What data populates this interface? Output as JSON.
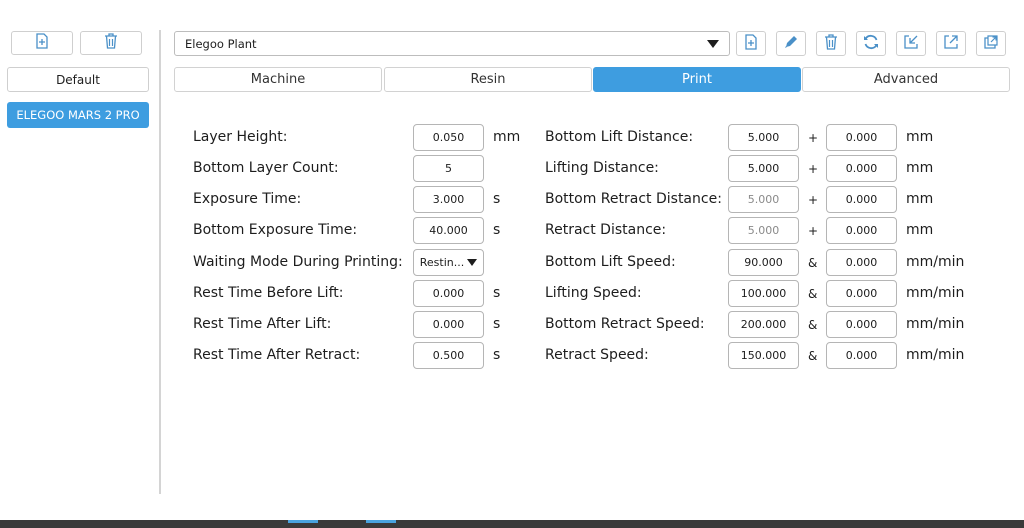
{
  "sidebar": {
    "add_button_icon": "add-file-icon",
    "delete_button_icon": "trash-icon",
    "profiles": [
      "Default",
      "ELEGOO MARS 2 PRO"
    ],
    "selected_index": 1
  },
  "preset": {
    "value": "Elegoo Plant",
    "tool_icons": [
      "add-file-icon",
      "pencil-icon",
      "trash-icon",
      "refresh-icon",
      "import-icon",
      "export-icon",
      "copy-out-icon"
    ]
  },
  "tabs": [
    "Machine",
    "Resin",
    "Print",
    "Advanced"
  ],
  "active_tab": "Print",
  "left_params": [
    {
      "label": "Layer Height:",
      "value": "0.050",
      "unit": "mm"
    },
    {
      "label": "Bottom Layer Count:",
      "value": "5",
      "unit": ""
    },
    {
      "label": "Exposure Time:",
      "value": "3.000",
      "unit": "s"
    },
    {
      "label": "Bottom Exposure Time:",
      "value": "40.000",
      "unit": "s"
    },
    {
      "label": "Waiting Mode During Printing:",
      "value": "Restin...",
      "unit": ""
    },
    {
      "label": "Rest Time Before Lift:",
      "value": "0.000",
      "unit": "s"
    },
    {
      "label": "Rest Time After Lift:",
      "value": "0.000",
      "unit": "s"
    },
    {
      "label": "Rest Time After Retract:",
      "value": "0.500",
      "unit": "s"
    }
  ],
  "right_params": [
    {
      "label": "Bottom Lift Distance:",
      "value1": "5.000",
      "op": "+",
      "value2": "0.000",
      "unit": "mm"
    },
    {
      "label": "Lifting Distance:",
      "value1": "5.000",
      "op": "+",
      "value2": "0.000",
      "unit": "mm"
    },
    {
      "label": "Bottom Retract Distance:",
      "value1": "5.000",
      "op": "+",
      "value2": "0.000",
      "unit": "mm"
    },
    {
      "label": "Retract Distance:",
      "value1": "5.000",
      "op": "+",
      "value2": "0.000",
      "unit": "mm"
    },
    {
      "label": "Bottom Lift Speed:",
      "value1": "90.000",
      "op": "&",
      "value2": "0.000",
      "unit": "mm/min"
    },
    {
      "label": "Lifting Speed:",
      "value1": "100.000",
      "op": "&",
      "value2": "0.000",
      "unit": "mm/min"
    },
    {
      "label": "Bottom Retract Speed:",
      "value1": "200.000",
      "op": "&",
      "value2": "0.000",
      "unit": "mm/min"
    },
    {
      "label": "Retract Speed:",
      "value1": "150.000",
      "op": "&",
      "value2": "0.000",
      "unit": "mm/min"
    }
  ],
  "colors": {
    "accent": "#3e9de0",
    "icon": "#4a90c8"
  }
}
